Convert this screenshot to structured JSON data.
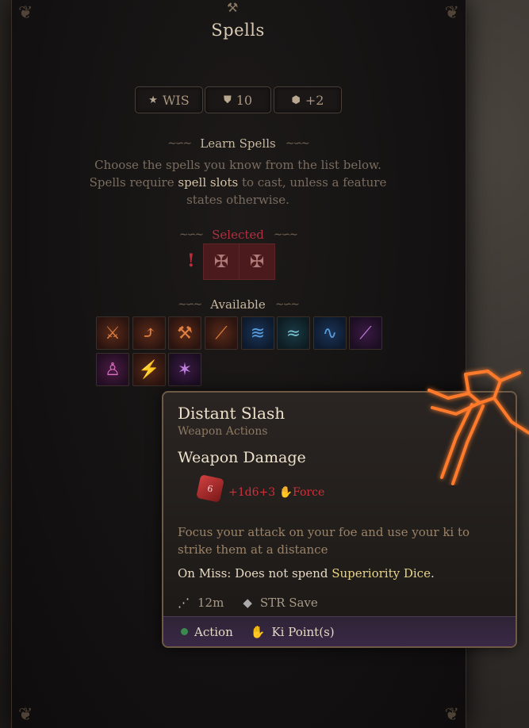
{
  "panel": {
    "title": "Spells",
    "stats": [
      {
        "icon": "star-icon",
        "glyph": "★",
        "label": "WIS"
      },
      {
        "icon": "shield-icon",
        "glyph": "⛊",
        "label": "10"
      },
      {
        "icon": "d20-icon",
        "glyph": "⬢",
        "label": "+2"
      }
    ],
    "learn_heading": "Learn Spells",
    "desc_before": "Choose the spells you know from the list below. Spells require ",
    "desc_highlight": "spell slots",
    "desc_after": " to cast, unless a feature states otherwise.",
    "selected_heading": "Selected",
    "available_heading": "Available"
  },
  "available_spells": [
    {
      "icon": "sword-strike-icon",
      "color": "orange"
    },
    {
      "icon": "leaping-strike-icon",
      "color": "orange"
    },
    {
      "icon": "hammer-strike-icon",
      "color": "orange"
    },
    {
      "icon": "slashing-blade-icon",
      "color": "orange"
    },
    {
      "icon": "water-wave-icon",
      "color": "blue"
    },
    {
      "icon": "wind-gust-icon",
      "color": "teal"
    },
    {
      "icon": "water-whip-icon",
      "color": "blue"
    },
    {
      "icon": "purple-slash-icon",
      "color": "purple"
    },
    {
      "icon": "figure-icon",
      "color": "magenta"
    },
    {
      "icon": "distant-slash-icon",
      "color": "orange"
    },
    {
      "icon": "purple-figures-icon",
      "color": "purple"
    }
  ],
  "tooltip": {
    "name": "Distant Slash",
    "category": "Weapon Actions",
    "section": "Weapon Damage",
    "damage": "+1d6+3",
    "damage_type": "Force",
    "description": "Focus your attack on your foe and use your ki to strike them at a distance",
    "miss_prefix": "On Miss: Does not spend ",
    "miss_highlight": "Superiority Dice",
    "miss_suffix": ".",
    "range": "12m",
    "save": "STR Save",
    "cost_action": "Action",
    "cost_resource": "Ki Point(s)"
  },
  "colors": {
    "selected_red": "#b03040",
    "damage_red": "#d0303a",
    "highlight_gold": "#e8d58a",
    "glow_orange": "#ff6a1a"
  }
}
